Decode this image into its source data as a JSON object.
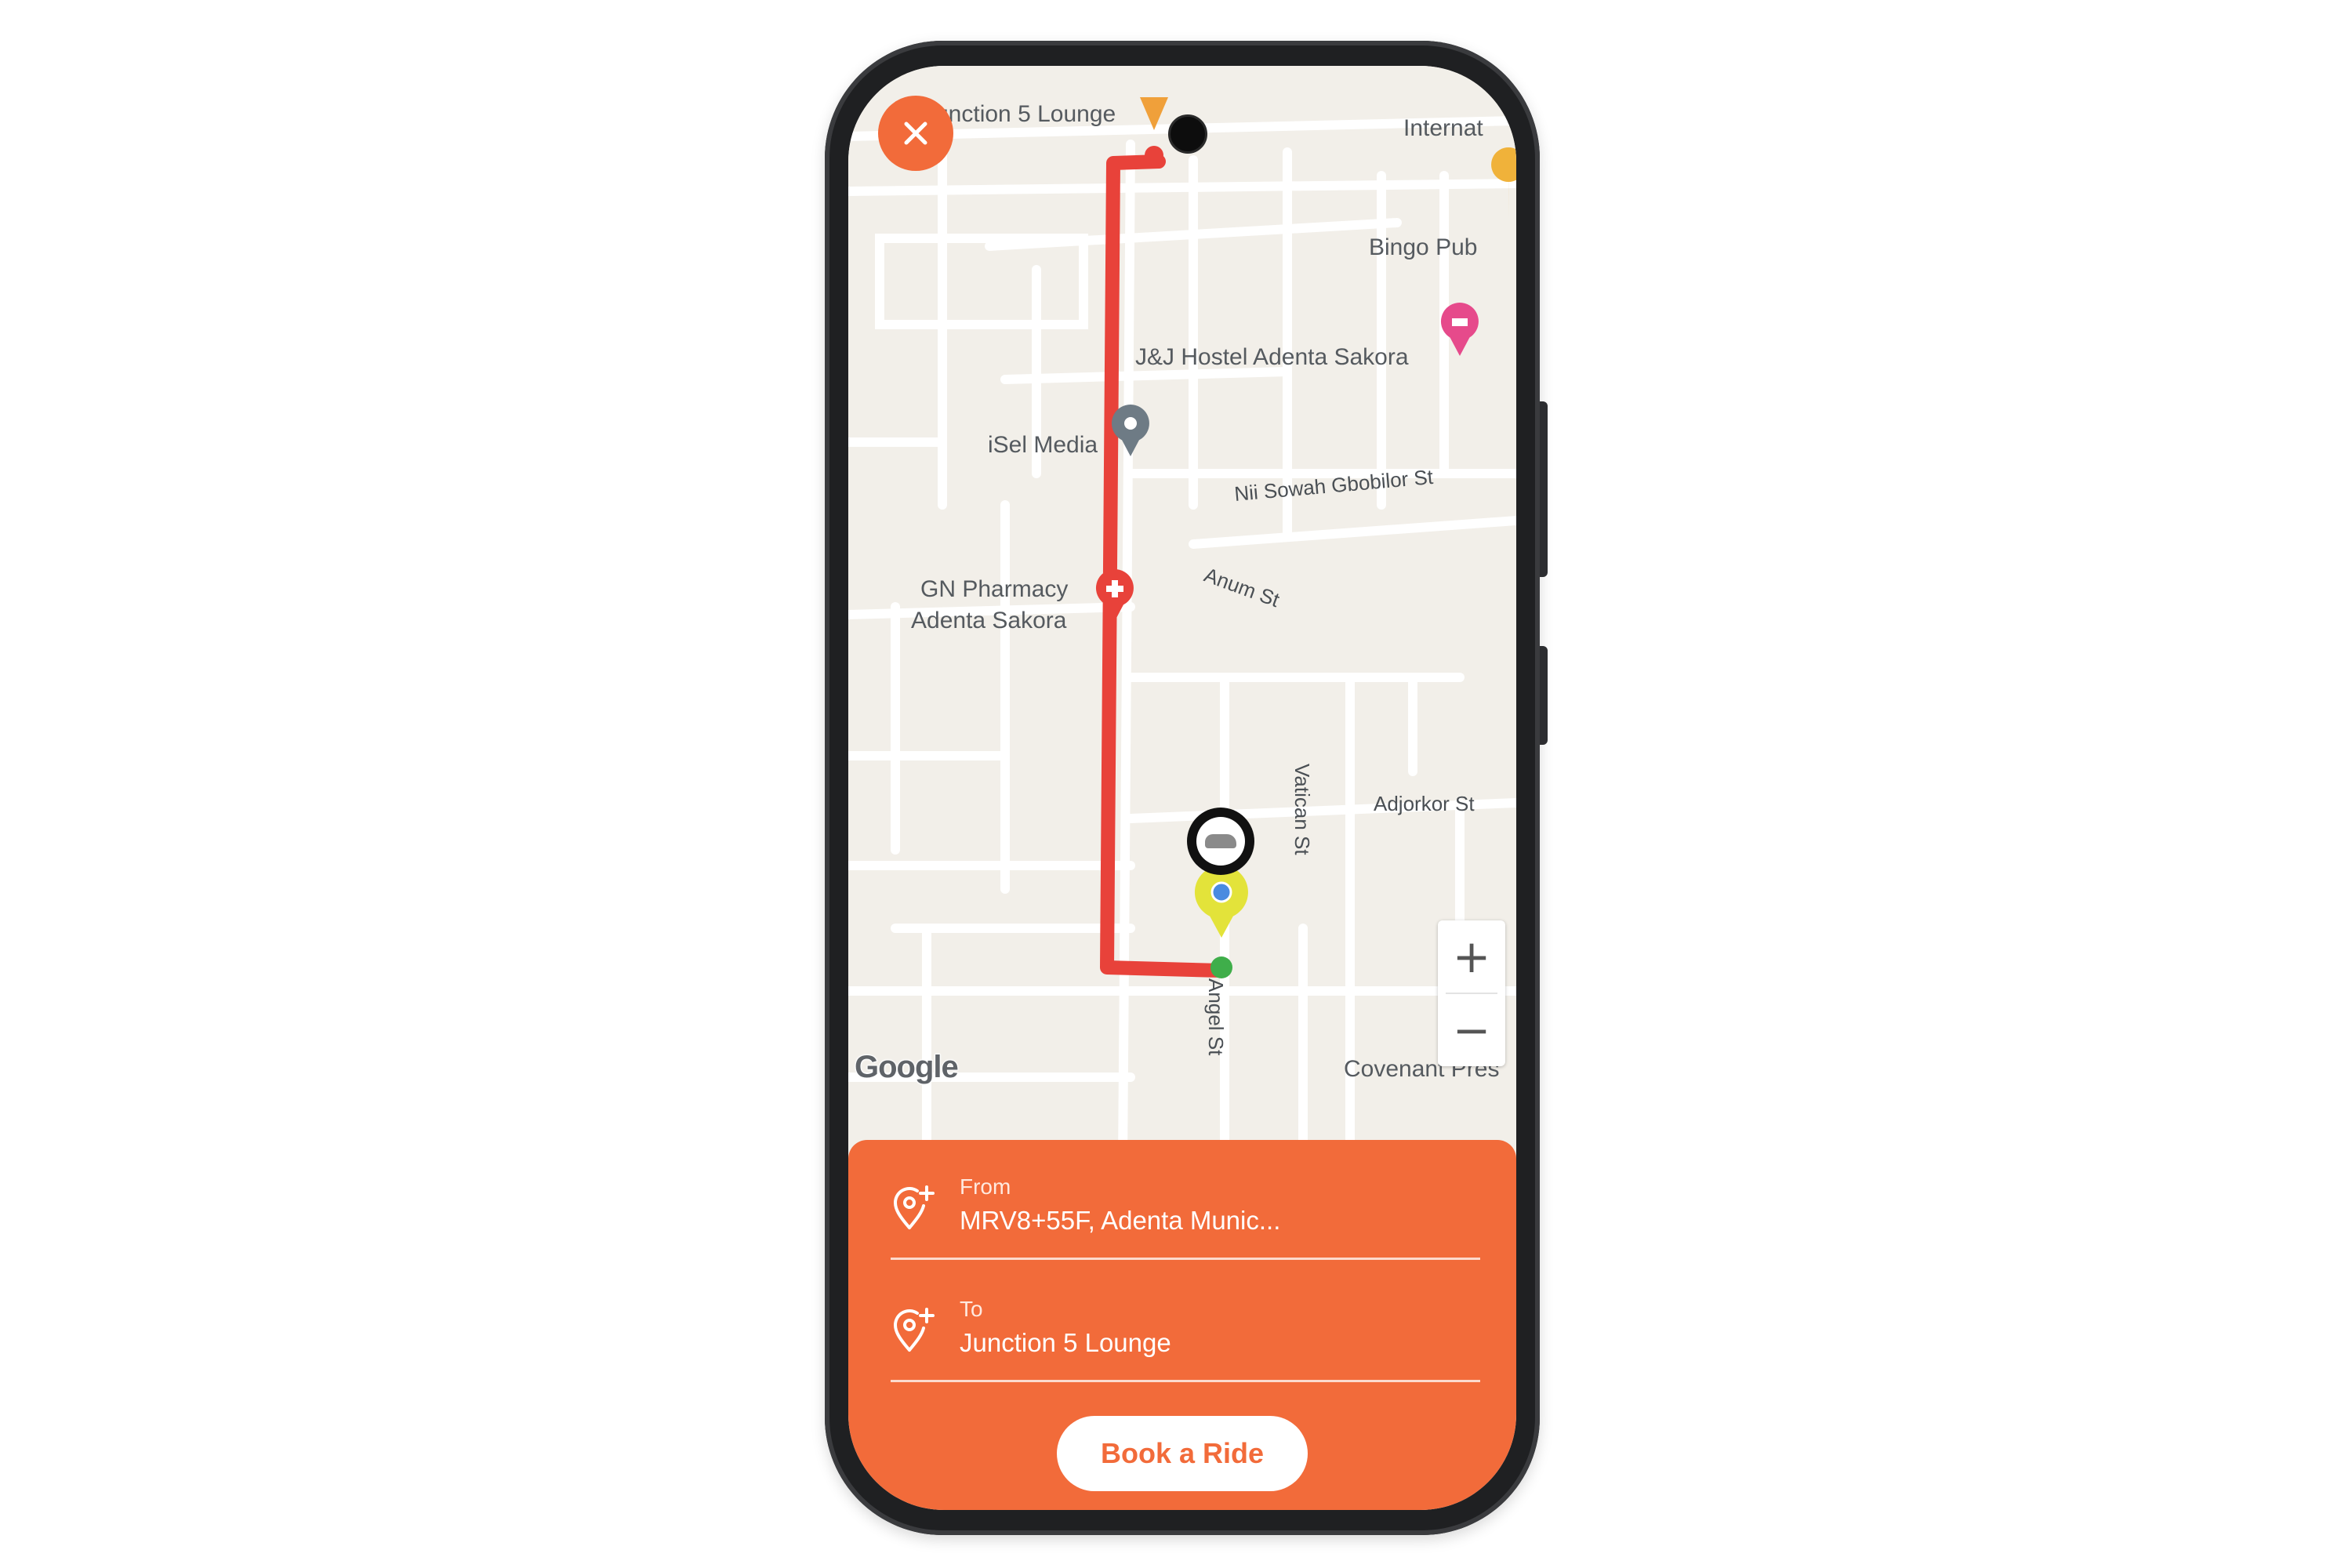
{
  "map": {
    "places": {
      "junction_lounge": "Junction 5 Lounge",
      "international": "Internat",
      "bingo_pub": "Bingo Pub",
      "hostel": "J&J Hostel Adenta Sakora",
      "isel_media": "iSel Media",
      "pharmacy_line1": "GN Pharmacy",
      "pharmacy_line2": "Adenta Sakora",
      "covenant": "Covenant Pres"
    },
    "streets": {
      "nii_sowah": "Nii Sowah Gbobilor St",
      "anum": "Anum St",
      "vatican": "Vatican St",
      "adjorkor": "Adjorkor St",
      "angel": "Angel St"
    },
    "attribution": "Google",
    "zoom_in": "+",
    "zoom_out": "−"
  },
  "route": {
    "color": "#e8423a"
  },
  "booking": {
    "from_label": "From",
    "from_value": "MRV8+55F, Adenta Munic...",
    "to_label": "To",
    "to_value": "Junction 5 Lounge",
    "book_button": "Book a Ride"
  },
  "colors": {
    "accent": "#f26b3a",
    "route": "#e8423a",
    "map_bg": "#f2efe9"
  },
  "icons": {
    "close": "close-icon",
    "location_add": "location-add-icon",
    "car_pin": "car-pin-icon"
  }
}
